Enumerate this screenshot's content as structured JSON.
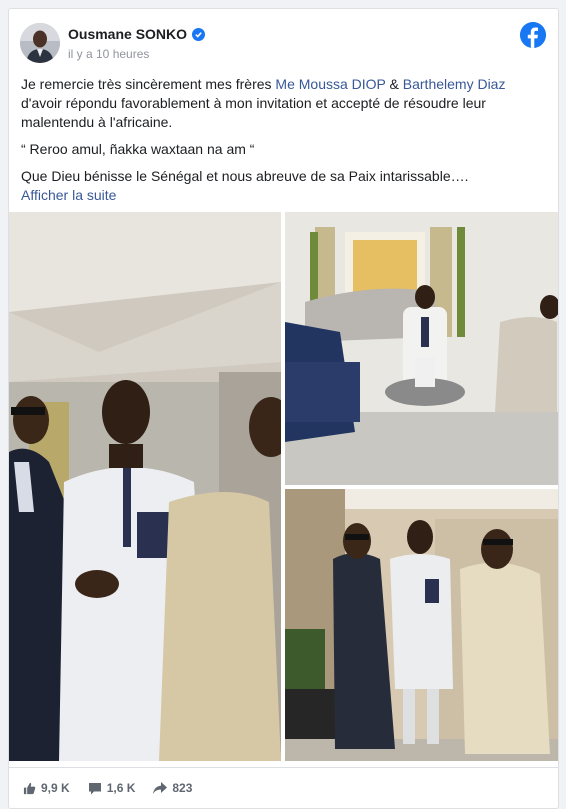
{
  "post": {
    "author": "Ousmane SONKO",
    "timestamp": "il y a 10 heures",
    "text_before": "Je remercie très sincèrement mes frères ",
    "mention1": "Me Moussa DIOP",
    "amp": " & ",
    "mention2": "Barthelemy Diaz",
    "text_after": " d'avoir répondu favorablement à mon invitation et accepté de résoudre leur malentendu à l'africaine.",
    "quote": "“ Reroo amul, ñakka waxtaan na am “",
    "blessing": "Que Dieu bénisse le Sénégal et nous abreuve de sa Paix intarissable….",
    "see_more": "Afficher la suite"
  },
  "stats": {
    "likes": "9,9 K",
    "comments": "1,6 K",
    "shares": "823"
  },
  "icons": {
    "brand": "facebook-logo-icon",
    "verified": "verified-badge-icon",
    "like": "thumbs-up-icon",
    "comment": "comment-bubble-icon",
    "share": "share-arrow-icon"
  },
  "colors": {
    "brand_blue": "#1877f2",
    "link": "#385898",
    "meta_gray": "#90949c"
  }
}
